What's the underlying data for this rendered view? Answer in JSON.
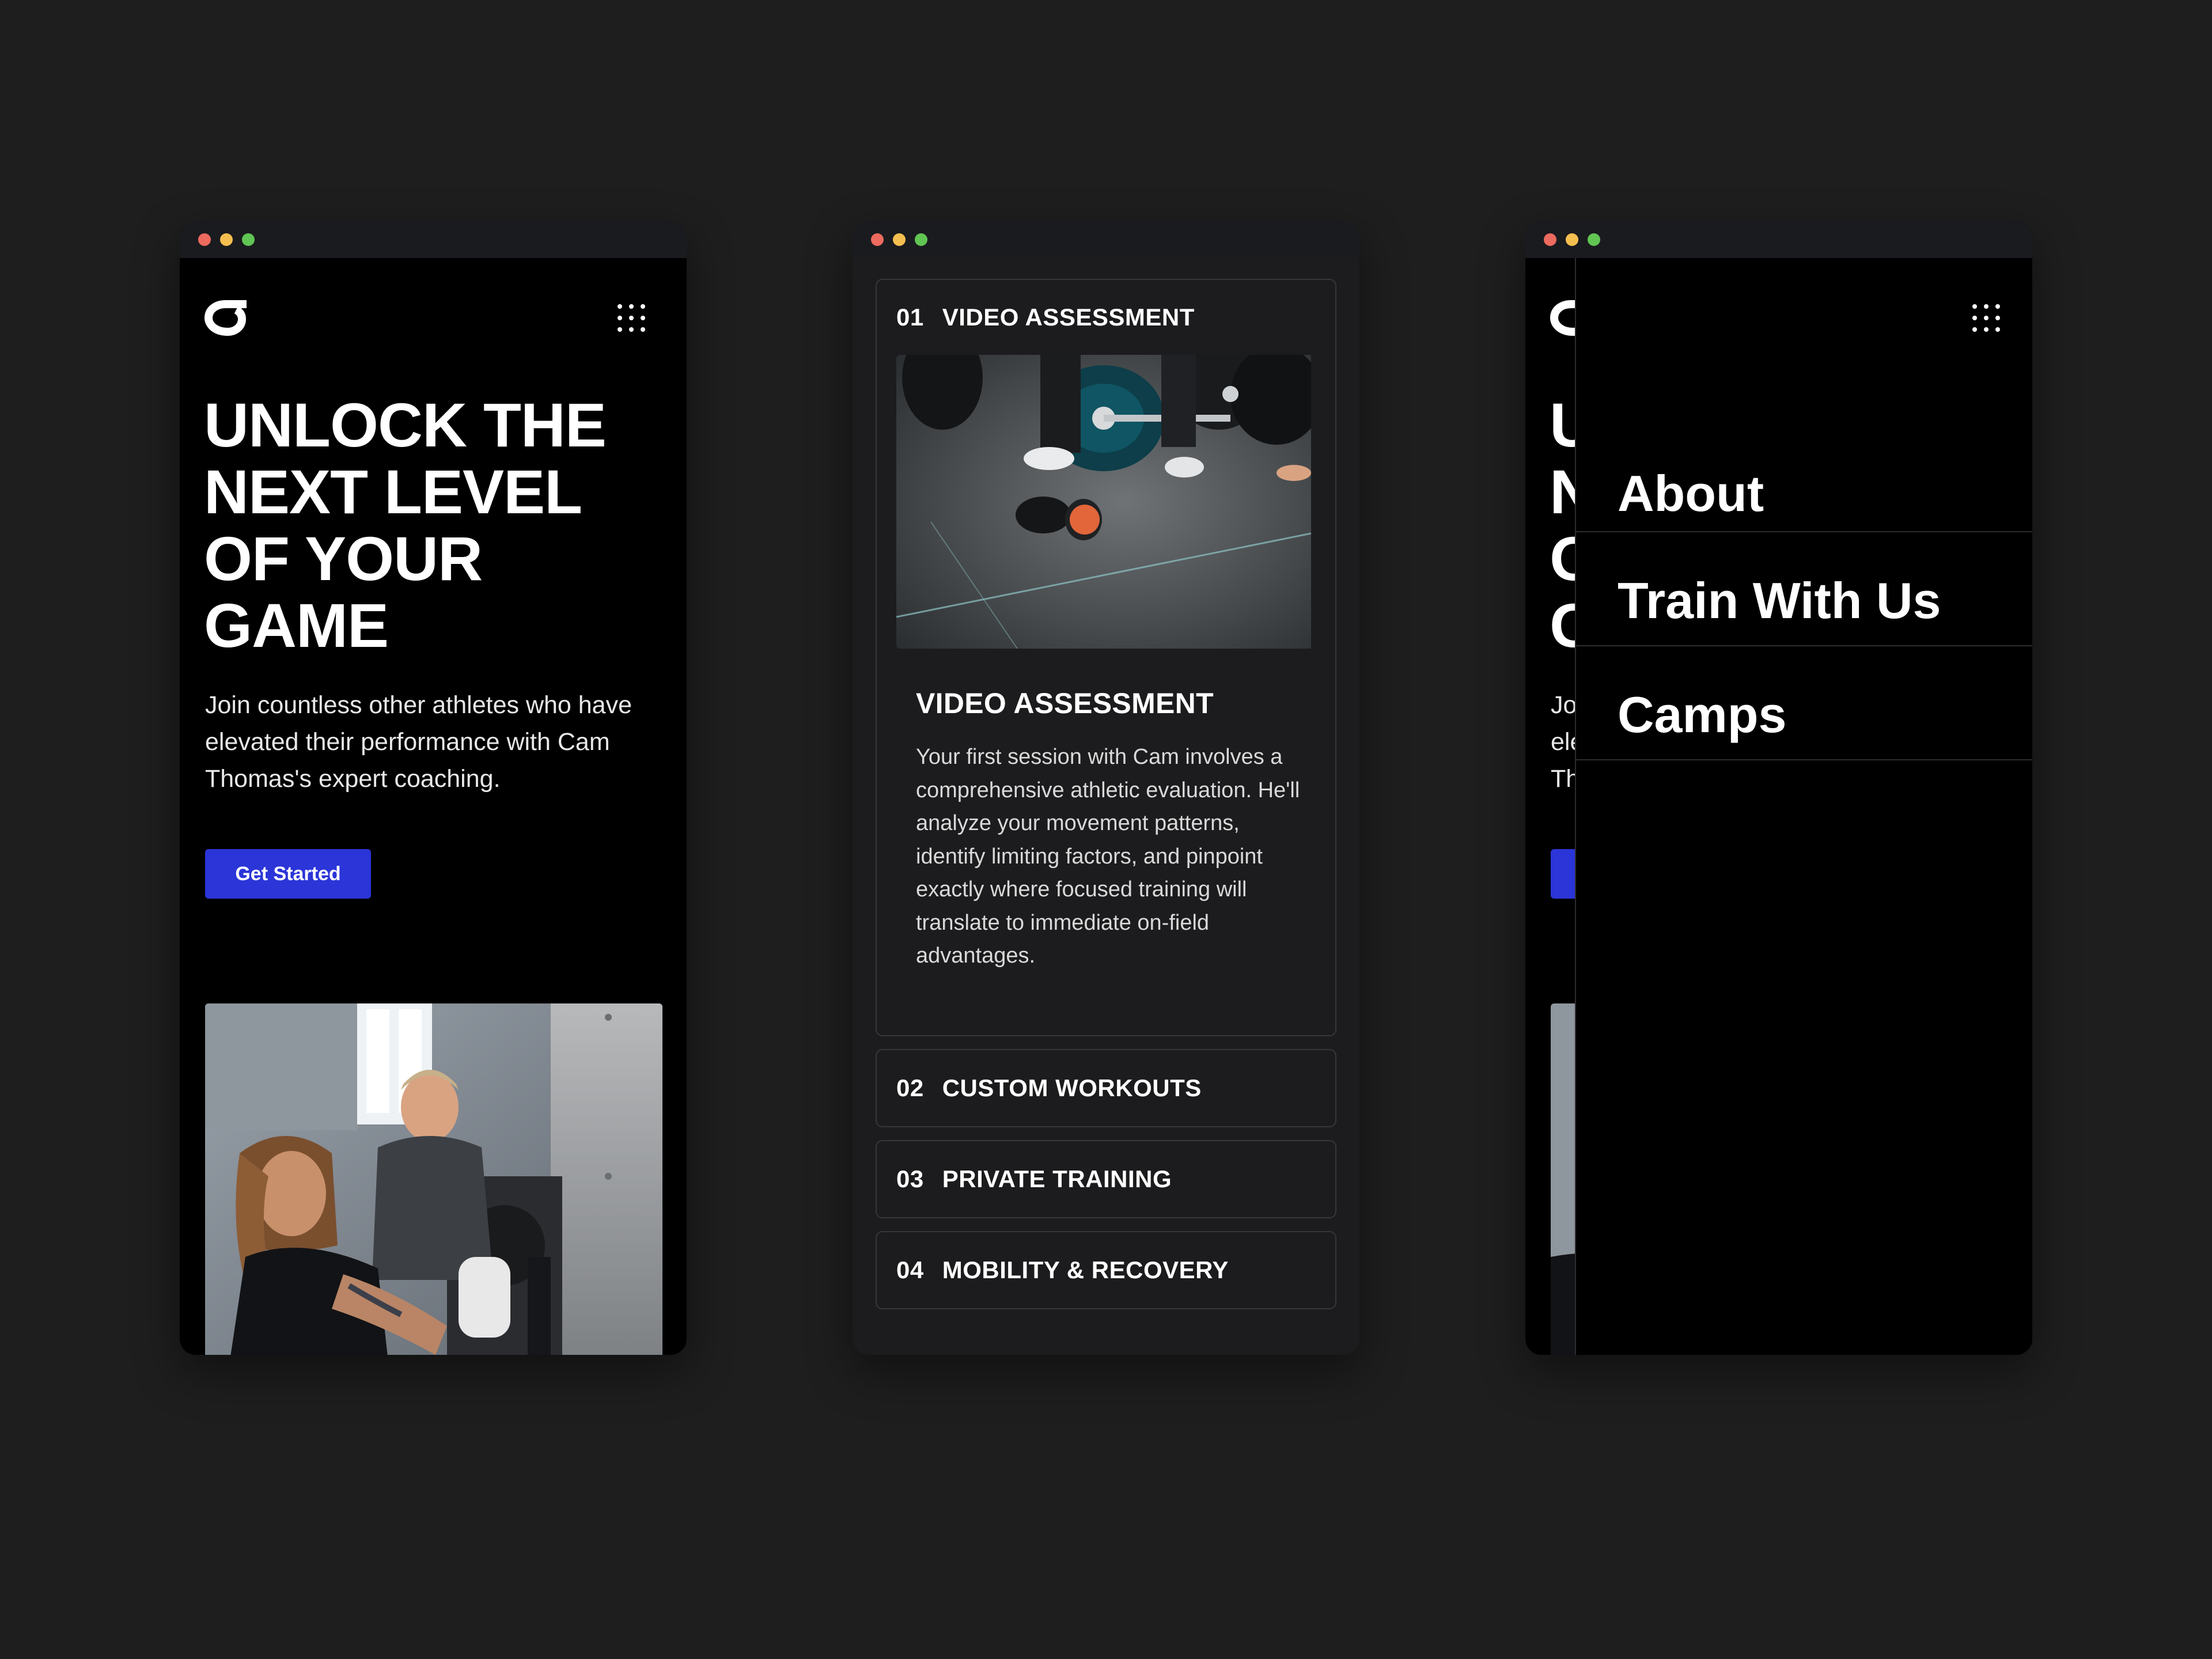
{
  "colors": {
    "page_bg": "#1e1e1e",
    "primary_button": "#2b35d8",
    "card_bg": "#1c1c1e",
    "border": "#36373b",
    "window_close": "#ed6a5e",
    "window_minimize": "#f5bf4f",
    "window_zoom": "#61c554"
  },
  "hero": {
    "logo_icon": "brand-logo-icon",
    "menu_icon": "grid-menu-icon",
    "title": "UNLOCK THE NEXT LEVEL OF YOUR GAME",
    "subtitle": "Join countless other athletes who have elevated their performance with Cam Thomas's expert coaching.",
    "cta_label": "Get Started",
    "photo_subject": "coach-training-athlete-photo"
  },
  "services": [
    {
      "number": "01",
      "title": "VIDEO ASSESSMENT",
      "expanded": true,
      "image_subject": "barbell-gym-floor-photo",
      "body_title": "VIDEO ASSESSMENT",
      "body": "Your first session with Cam involves a comprehensive athletic evaluation. He'll analyze your movement patterns, identify limiting factors, and pinpoint exactly where focused training will translate to immediate on-field advantages."
    },
    {
      "number": "02",
      "title": "CUSTOM WORKOUTS",
      "expanded": false
    },
    {
      "number": "03",
      "title": "PRIVATE TRAINING",
      "expanded": false
    },
    {
      "number": "04",
      "title": "MOBILITY & RECOVERY",
      "expanded": false
    }
  ],
  "nav_menu": {
    "items": [
      {
        "label": "About"
      },
      {
        "label": "Train With Us"
      },
      {
        "label": "Camps"
      }
    ]
  }
}
